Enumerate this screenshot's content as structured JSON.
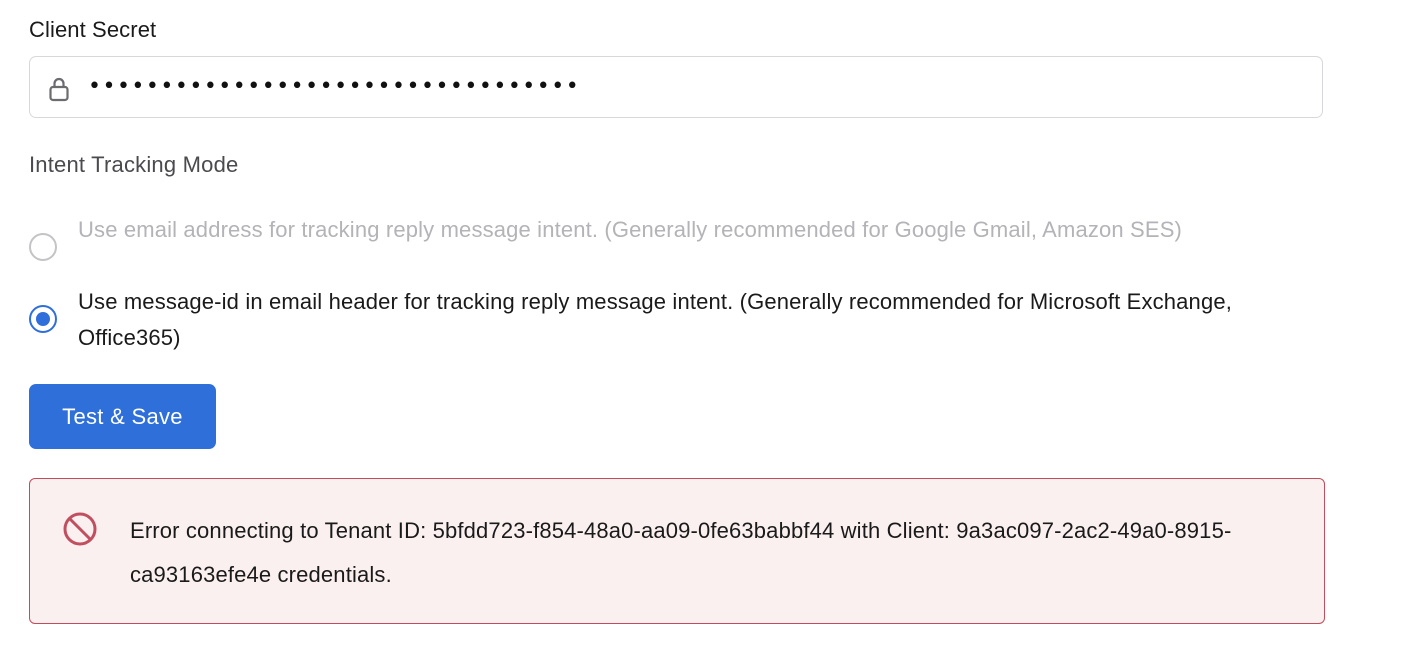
{
  "client_secret": {
    "label": "Client Secret",
    "masked_value": "••••••••••••••••••••••••••••••••••",
    "icon": "lock-icon"
  },
  "intent_tracking": {
    "label": "Intent Tracking Mode",
    "options": [
      {
        "label": "Use email address for tracking reply message intent. (Generally recommended for Google Gmail, Amazon SES)",
        "selected": false,
        "disabled": true
      },
      {
        "label": "Use message-id in email header for tracking reply message intent. (Generally recommended for Microsoft Exchange, Office365)",
        "selected": true,
        "disabled": false
      }
    ]
  },
  "actions": {
    "test_save_label": "Test & Save"
  },
  "error": {
    "icon": "ban-icon",
    "message": "Error connecting to Tenant ID: 5bfdd723-f854-48a0-aa09-0fe63babbf44 with Client: 9a3ac097-2ac2-49a0-8915-ca93163efe4e credentials."
  },
  "colors": {
    "accent": "#2f6fda",
    "error_border": "#c44b5c",
    "error_background": "#fbf0f0",
    "error_icon": "#c0505f",
    "disabled_text": "#b3b3b8"
  }
}
